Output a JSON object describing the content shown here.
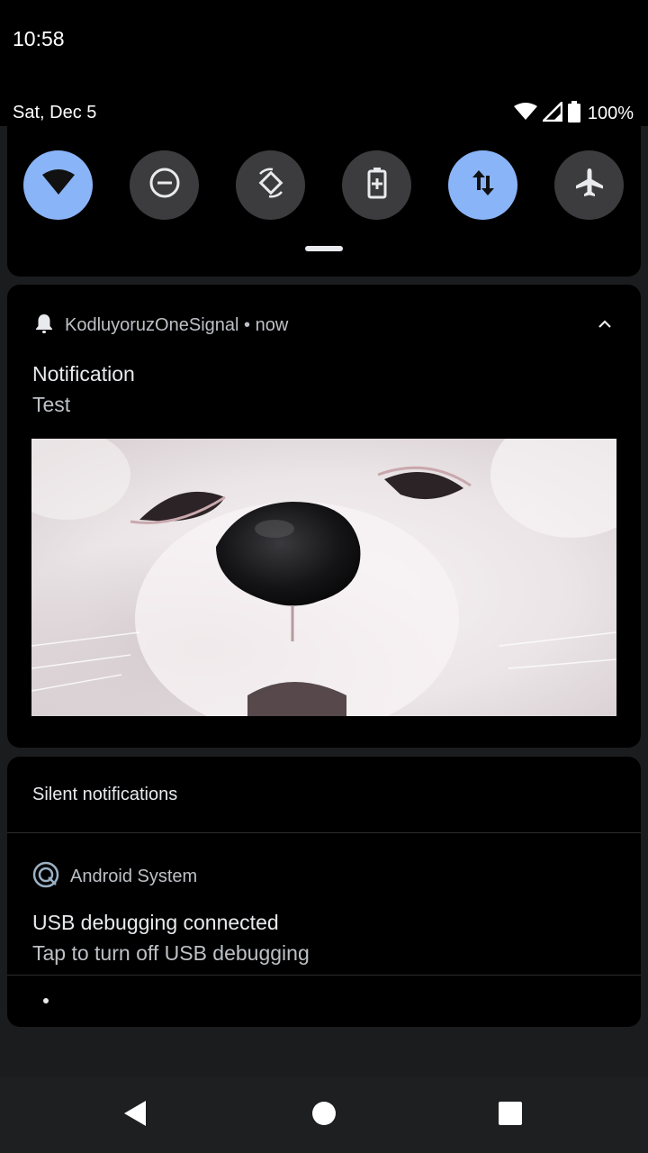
{
  "status_bar": {
    "time": "10:58",
    "date": "Sat, Dec 5",
    "battery": "100%",
    "icons": [
      "wifi-icon",
      "cell-signal-icon",
      "battery-icon"
    ]
  },
  "quick_settings": {
    "tiles": [
      {
        "name": "wifi",
        "icon": "wifi-icon",
        "state": "on"
      },
      {
        "name": "do-not-disturb",
        "icon": "do-not-disturb-icon",
        "state": "off"
      },
      {
        "name": "auto-rotate",
        "icon": "auto-rotate-icon",
        "state": "off"
      },
      {
        "name": "battery-saver",
        "icon": "battery-saver-icon",
        "state": "off"
      },
      {
        "name": "mobile-data",
        "icon": "mobile-data-icon",
        "state": "on"
      },
      {
        "name": "airplane-mode",
        "icon": "airplane-icon",
        "state": "off"
      }
    ]
  },
  "notification": {
    "app_name": "KodluyoruzOneSignal",
    "separator": "•",
    "time": "now",
    "title": "Notification",
    "text": "Test",
    "image": "samoyed-dog-close-up"
  },
  "silent": {
    "header": "Silent notifications",
    "item": {
      "app_name": "Android System",
      "title": "USB debugging connected",
      "text": "Tap to turn off USB debugging"
    }
  },
  "colors": {
    "accent": "#8ab4f8",
    "tile_off": "#3c3c3e",
    "card_bg": "#000000",
    "shade_bg": "#1b1c1e"
  }
}
